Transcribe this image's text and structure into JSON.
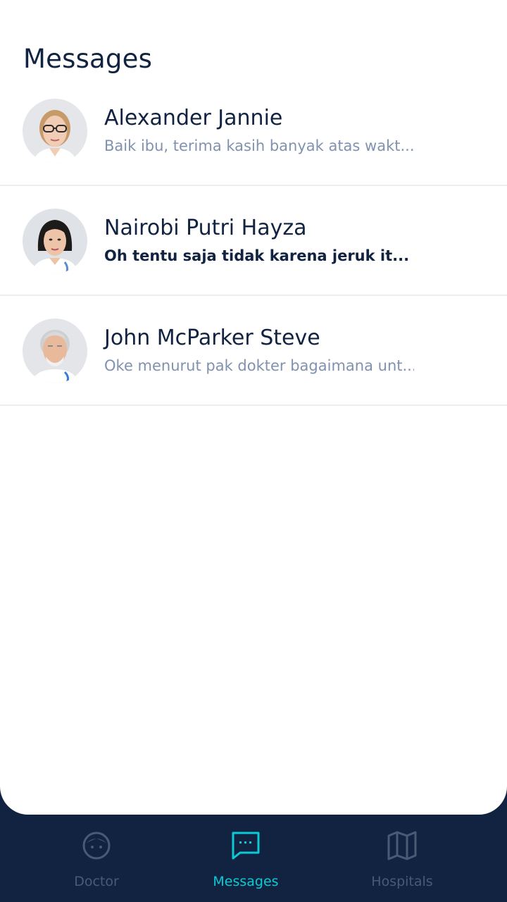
{
  "page": {
    "title": "Messages"
  },
  "messages": [
    {
      "name": "Alexander Jannie",
      "preview": "Baik ibu, terima kasih banyak atas wakt...",
      "unread": false,
      "avatar": "female-doctor-glasses-avatar"
    },
    {
      "name": "Nairobi Putri Hayza",
      "preview": "Oh tentu saja tidak karena jeruk it...",
      "unread": true,
      "avatar": "female-doctor-avatar"
    },
    {
      "name": "John McParker Steve",
      "preview": "Oke menurut pak dokter bagaimana unt...",
      "unread": false,
      "avatar": "male-doctor-avatar"
    }
  ],
  "tabs": [
    {
      "label": "Doctor",
      "icon": "doctor-face-icon",
      "active": false
    },
    {
      "label": "Messages",
      "icon": "chat-bubble-icon",
      "active": true
    },
    {
      "label": "Hospitals",
      "icon": "map-icon",
      "active": false
    }
  ],
  "colors": {
    "primary": "#112340",
    "accent": "#0BCAD4",
    "secondary_text": "#8092AF",
    "inactive_tab": "#495A75",
    "divider": "#EEEEEE"
  }
}
